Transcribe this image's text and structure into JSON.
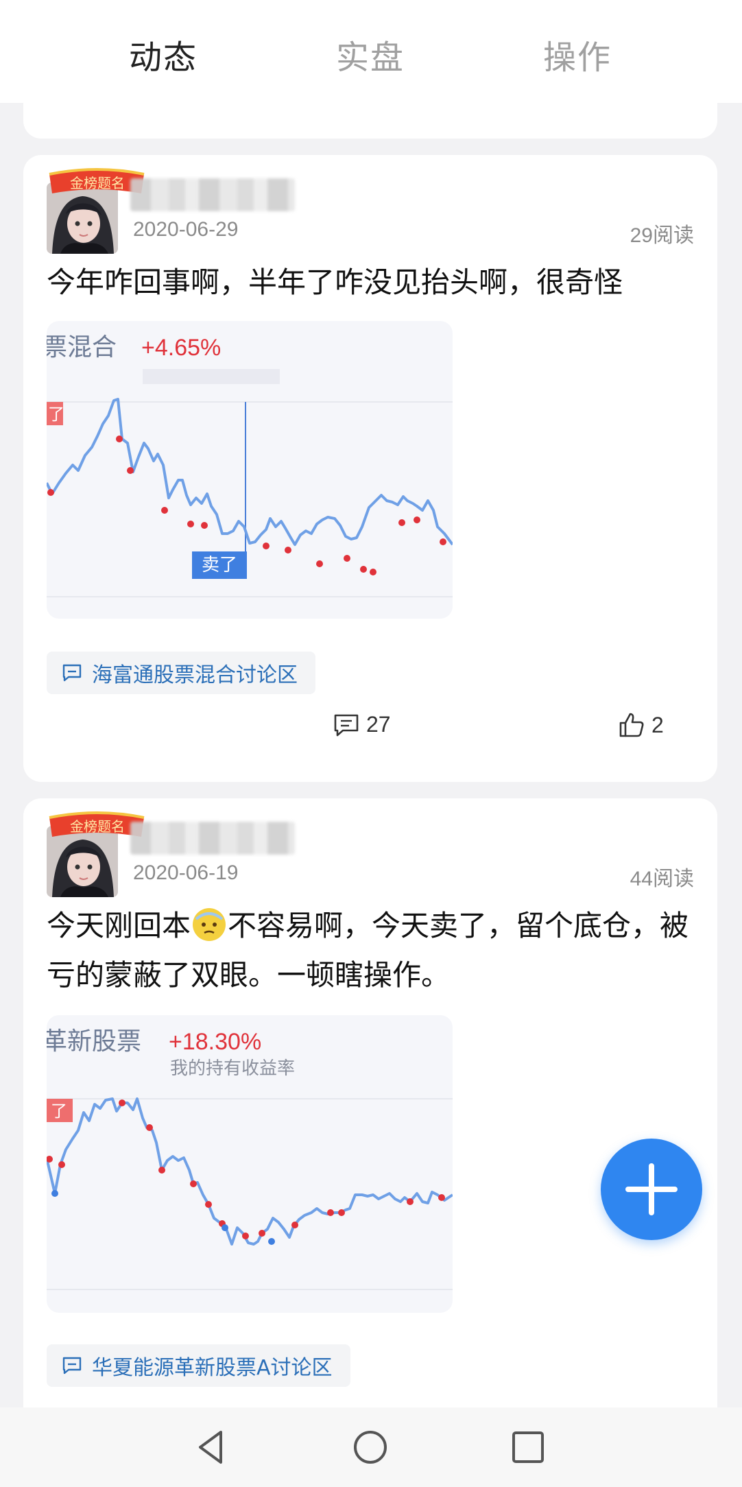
{
  "tabs": [
    {
      "label": "动态",
      "active": true
    },
    {
      "label": "实盘",
      "active": false
    },
    {
      "label": "操作",
      "active": false
    }
  ],
  "posts": [
    {
      "date": "2020-06-29",
      "reads": "29阅读",
      "content": "今年咋回事啊，半年了咋没见抬头啊，很奇怪",
      "chart": {
        "fund_name": "票混合",
        "return": "+4.65%",
        "return_label": "",
        "flag_label": "了",
        "sell_label": "卖了"
      },
      "forum": "海富通股票混合讨论区",
      "comments": "27",
      "likes": "2"
    },
    {
      "date": "2020-06-19",
      "reads": "44阅读",
      "content_before": "今天刚回本",
      "content_after": "不容易啊，今天卖了，留个底仓，被亏的蒙蔽了双眼。一顿瞎操作。",
      "chart": {
        "fund_name": "革新股票",
        "return": "+18.30%",
        "return_label": "我的持有收益率",
        "flag_label": "了"
      },
      "forum": "华夏能源革新股票A讨论区"
    }
  ],
  "colors": {
    "accent": "#2f86f0",
    "link": "#2b6fb8",
    "positive": "#e0323a",
    "line": "#6fa0e6"
  },
  "badge_text": "金榜题名"
}
